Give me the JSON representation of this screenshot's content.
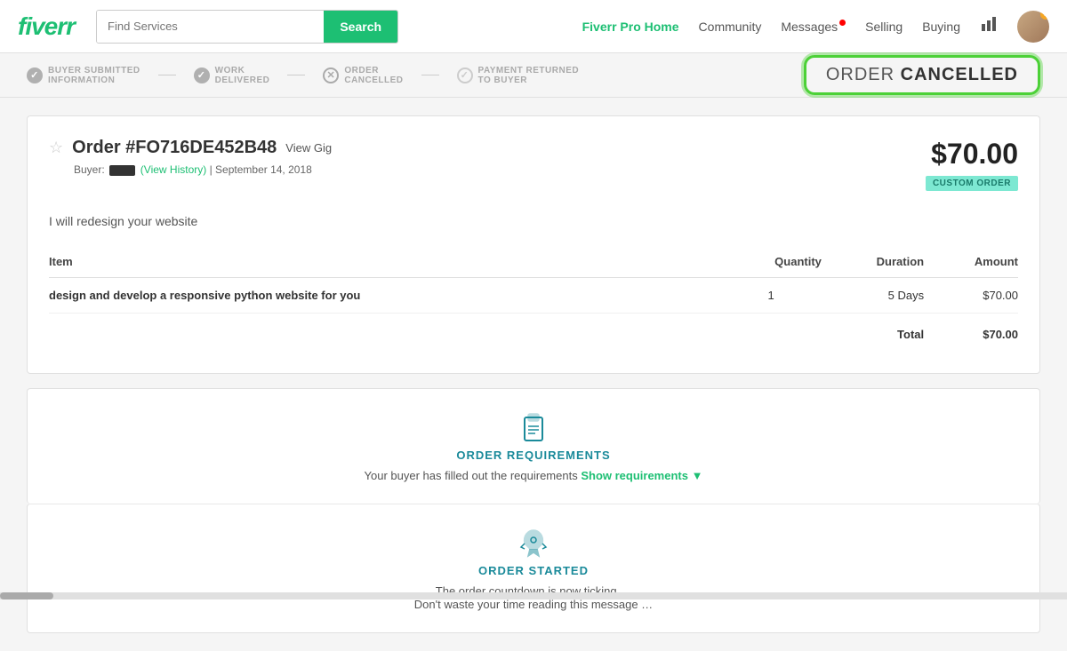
{
  "header": {
    "logo": "fiverr",
    "search_placeholder": "Find Services",
    "search_button": "Search",
    "nav": {
      "pro_home": "Fiverr Pro Home",
      "community": "Community",
      "messages": "Messages",
      "messages_has_dot": true,
      "selling": "Selling",
      "buying": "Buying"
    }
  },
  "status_bar": {
    "steps": [
      {
        "label": "BUYER SUBMITTED\nINFORMATION",
        "icon": "check",
        "type": "check"
      },
      {
        "label": "WORK\nDELIVERED",
        "icon": "check",
        "type": "check"
      },
      {
        "label": "ORDER\nCANCELLED",
        "icon": "x",
        "type": "x"
      },
      {
        "label": "PAYMENT RETURNED\nTO BUYER",
        "icon": "check",
        "type": "check_outline"
      }
    ],
    "cancelled_badge": {
      "prefix": "ORDER ",
      "suffix": "CANCELLED"
    }
  },
  "order": {
    "star_label": "☆",
    "number": "Order #FO716DE452B48",
    "view_gig": "View Gig",
    "buyer_label": "Buyer:",
    "buyer_name": "████████",
    "view_history": "(View History)",
    "date": "September 14, 2018",
    "price": "$70.00",
    "custom_order_badge": "CUSTOM ORDER",
    "description": "I will redesign your website",
    "table": {
      "headers": [
        "Item",
        "Quantity",
        "Duration",
        "Amount"
      ],
      "rows": [
        {
          "item": "design and develop a responsive python website for you",
          "quantity": "1",
          "duration": "5 Days",
          "amount": "$70.00"
        }
      ],
      "total_label": "Total",
      "total_value": "$70.00"
    }
  },
  "sections": {
    "requirements": {
      "title": "ORDER REQUIREMENTS",
      "desc_prefix": "Your buyer has filled out the requirements",
      "show_req": "Show requirements ▼"
    },
    "started": {
      "title": "ORDER STARTED",
      "desc_line1": "The order countdown is now ticking …",
      "desc_line2": "Don't waste your time reading this message …"
    }
  }
}
